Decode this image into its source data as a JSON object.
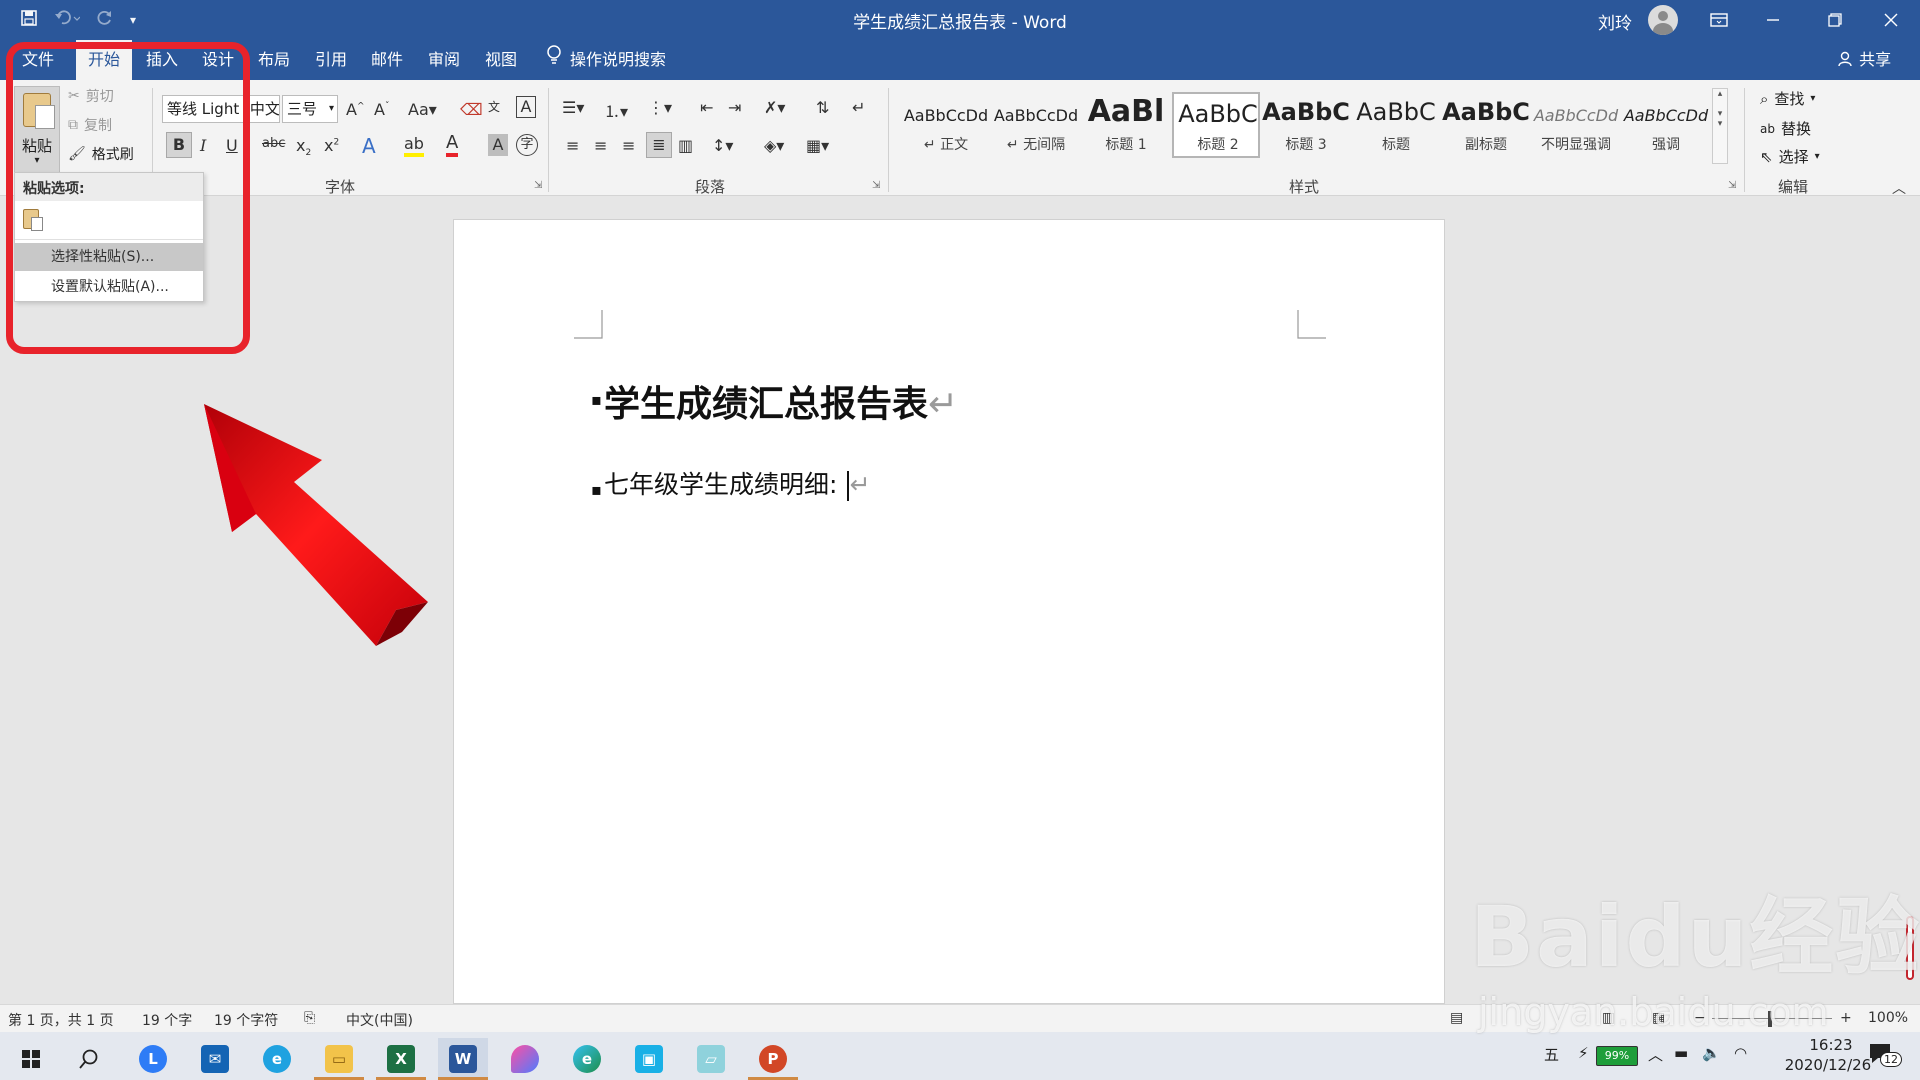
{
  "window": {
    "title": "学生成绩汇总报告表 - Word",
    "user": "刘玲",
    "controls": [
      "ribbon-display",
      "restore",
      "close"
    ]
  },
  "quick_access": {
    "icons": [
      "save-icon",
      "undo-icon",
      "redo-icon",
      "customize-icon"
    ]
  },
  "tabs": {
    "items": [
      {
        "label": "文件"
      },
      {
        "label": "开始",
        "active": true
      },
      {
        "label": "插入"
      },
      {
        "label": "设计"
      },
      {
        "label": "布局"
      },
      {
        "label": "引用"
      },
      {
        "label": "邮件"
      },
      {
        "label": "审阅"
      },
      {
        "label": "视图"
      }
    ],
    "tell_me": "操作说明搜索",
    "share": "共享"
  },
  "ribbon": {
    "clipboard": {
      "paste": "粘贴",
      "cut": "剪切",
      "copy": "复制",
      "format_painter": "格式刷"
    },
    "font": {
      "font_name": "等线 Light (中文",
      "font_size": "三号",
      "group_label": "字体"
    },
    "paragraph": {
      "group_label": "段落"
    },
    "styles": {
      "group_label": "样式",
      "items": [
        {
          "sample": "AaBbCcDd",
          "name": "↵ 正文"
        },
        {
          "sample": "AaBbCcDd",
          "name": "↵ 无间隔"
        },
        {
          "sample": "AaBl",
          "name": "标题 1"
        },
        {
          "sample": "AaBbC",
          "name": "标题 2",
          "selected": true
        },
        {
          "sample": "AaBbC",
          "name": "标题 3"
        },
        {
          "sample": "AaBbC",
          "name": "标题"
        },
        {
          "sample": "AaBbC",
          "name": "副标题"
        },
        {
          "sample": "AaBbCcDd",
          "name": "不明显强调"
        },
        {
          "sample": "AaBbCcDd",
          "name": "强调"
        }
      ]
    },
    "editing": {
      "find": "查找",
      "replace": "替换",
      "select": "选择",
      "group_label": "编辑"
    }
  },
  "paste_menu": {
    "header": "粘贴选项:",
    "paste_special": "选择性粘贴(S)...",
    "set_default": "设置默认粘贴(A)..."
  },
  "document": {
    "heading": "学生成绩汇总报告表",
    "line1": "七年级学生成绩明细:",
    "paragraph_mark": "↵"
  },
  "statusbar": {
    "page": "第 1 页，共 1 页",
    "words": "19 个字",
    "chars": "19 个字符",
    "language": "中文(中国)",
    "zoom": "100%",
    "zoom_minus": "−",
    "zoom_plus": "+"
  },
  "taskbar": {
    "ime": "五",
    "battery": "99%",
    "time": "16:23",
    "date": "2020/12/26",
    "notifications": "12"
  },
  "watermark": {
    "brand": "Baidu经验",
    "url": "jingyan.baidu.com"
  },
  "colors": {
    "word_blue": "#2b579a",
    "annotation_red": "#e8232b"
  }
}
